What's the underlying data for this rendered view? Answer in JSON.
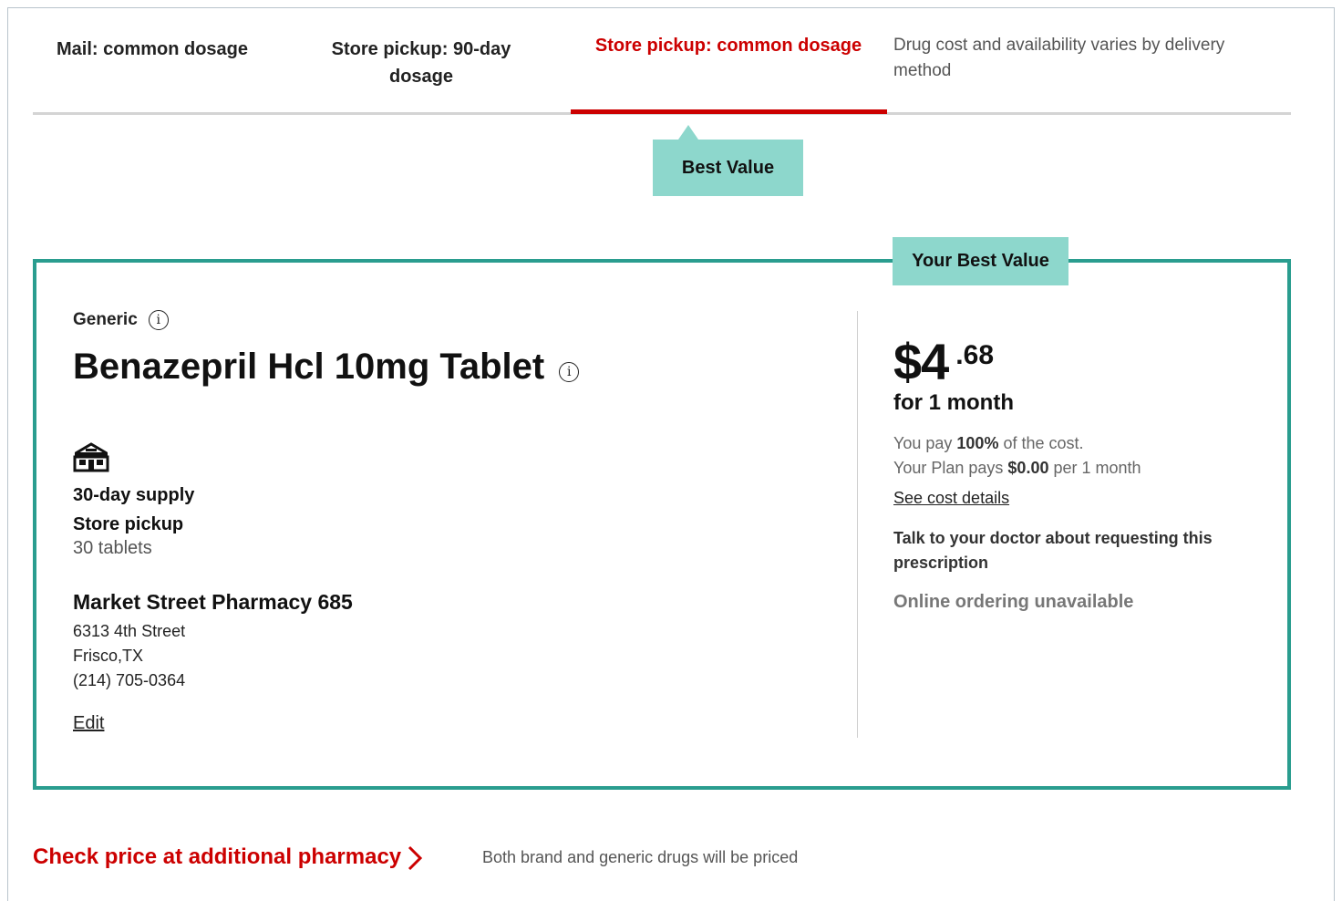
{
  "tabs": {
    "mail_common": "Mail: common dosage",
    "store_90": "Store pickup: 90-day dosage",
    "store_common": "Store pickup: common dosage",
    "note": "Drug cost and availability varies by delivery method"
  },
  "best_value_flag": "Best Value",
  "card": {
    "tag": "Your Best Value",
    "type_label": "Generic",
    "drug_name": "Benazepril Hcl 10mg Tablet",
    "supply": "30-day supply",
    "delivery": "Store pickup",
    "quantity": "30 tablets",
    "pharmacy": {
      "name": "Market Street Pharmacy 685",
      "street": "6313 4th Street",
      "city": "Frisco,TX",
      "phone": "(214) 705-0364"
    },
    "edit_label": "Edit",
    "price": {
      "dollars": "$4",
      "cents": ".68",
      "period": "for 1 month"
    },
    "you_pay_prefix": "You pay ",
    "you_pay_percent": "100%",
    "you_pay_suffix": " of the cost.",
    "plan_pays_prefix": "Your Plan pays ",
    "plan_pays_amount": "$0.00",
    "plan_pays_suffix": " per 1 month",
    "cost_details_label": "See cost details",
    "talk_note": "Talk to your doctor about requesting this prescription",
    "online_note": "Online ordering unavailable"
  },
  "footer": {
    "check_link": "Check price at additional pharmacy",
    "note": "Both brand and generic drugs will be priced"
  },
  "colors": {
    "accent_red": "#cc0000",
    "teal_border": "#2a9d8f",
    "teal_fill": "#8dd7cc"
  }
}
